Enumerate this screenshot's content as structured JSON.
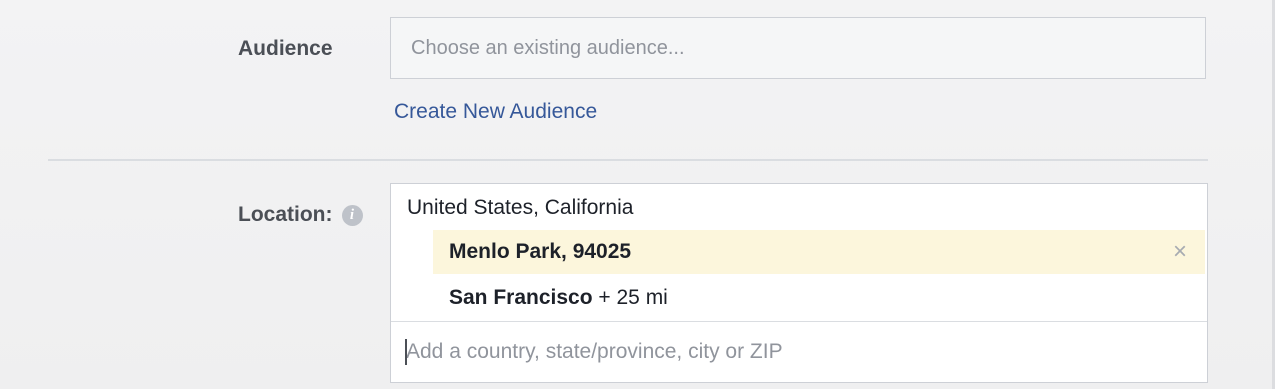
{
  "audience": {
    "label": "Audience",
    "placeholder": "Choose an existing audience...",
    "create_link": "Create New Audience"
  },
  "location": {
    "label": "Location:",
    "info_icon": "info-icon",
    "region": "United States, California",
    "items": [
      {
        "name": "Menlo Park, 94025",
        "suffix": "",
        "highlighted": true,
        "remove_icon": "close-icon",
        "remove_glyph": "×"
      },
      {
        "name": "San Francisco",
        "suffix": " + 25 mi",
        "highlighted": false
      }
    ],
    "input_placeholder": "Add a country, state/province, city or ZIP"
  },
  "colors": {
    "link": "#365899",
    "highlight": "#fcf6dc",
    "label": "#4b4f56",
    "border": "#cdd0d6"
  }
}
